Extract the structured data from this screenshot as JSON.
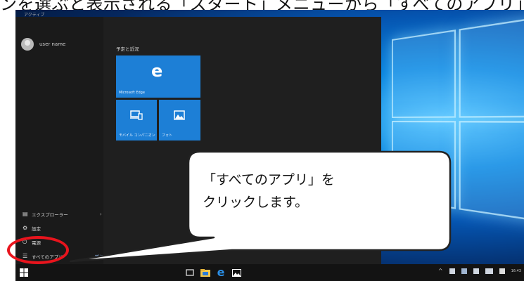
{
  "instruction_caption": "ンを選ぶと表示される「スタート」メニューから「すべてのアプリ」",
  "start_menu": {
    "top_label": "アクティブ",
    "user_name": "user name",
    "tiles_heading": "予定と近況",
    "tiles": [
      {
        "label": "Microsoft Edge",
        "icon": "edge-e-icon"
      },
      {
        "label": "モバイル コンパニオン",
        "icon": "devices-icon"
      },
      {
        "label": "フォト",
        "icon": "photos-icon"
      }
    ],
    "left_items": [
      {
        "label": "エクスプローラー",
        "icon": "folder-icon",
        "chevron": "›"
      },
      {
        "label": "設定",
        "icon": "gear-icon"
      },
      {
        "label": "電源",
        "icon": "power-icon"
      },
      {
        "label": "すべてのアプリ",
        "icon": "list-icon",
        "badge": "新規"
      }
    ]
  },
  "callout": {
    "line1": "「すべてのアプリ」を",
    "line2": "クリックします。"
  },
  "colors": {
    "tile_blue": "#1d7fd6",
    "highlight_ring": "#e8141d",
    "start_bg": "#1f1f1f",
    "taskbar_bg": "#131313"
  },
  "taskbar": {
    "tray_time": "16:43"
  }
}
